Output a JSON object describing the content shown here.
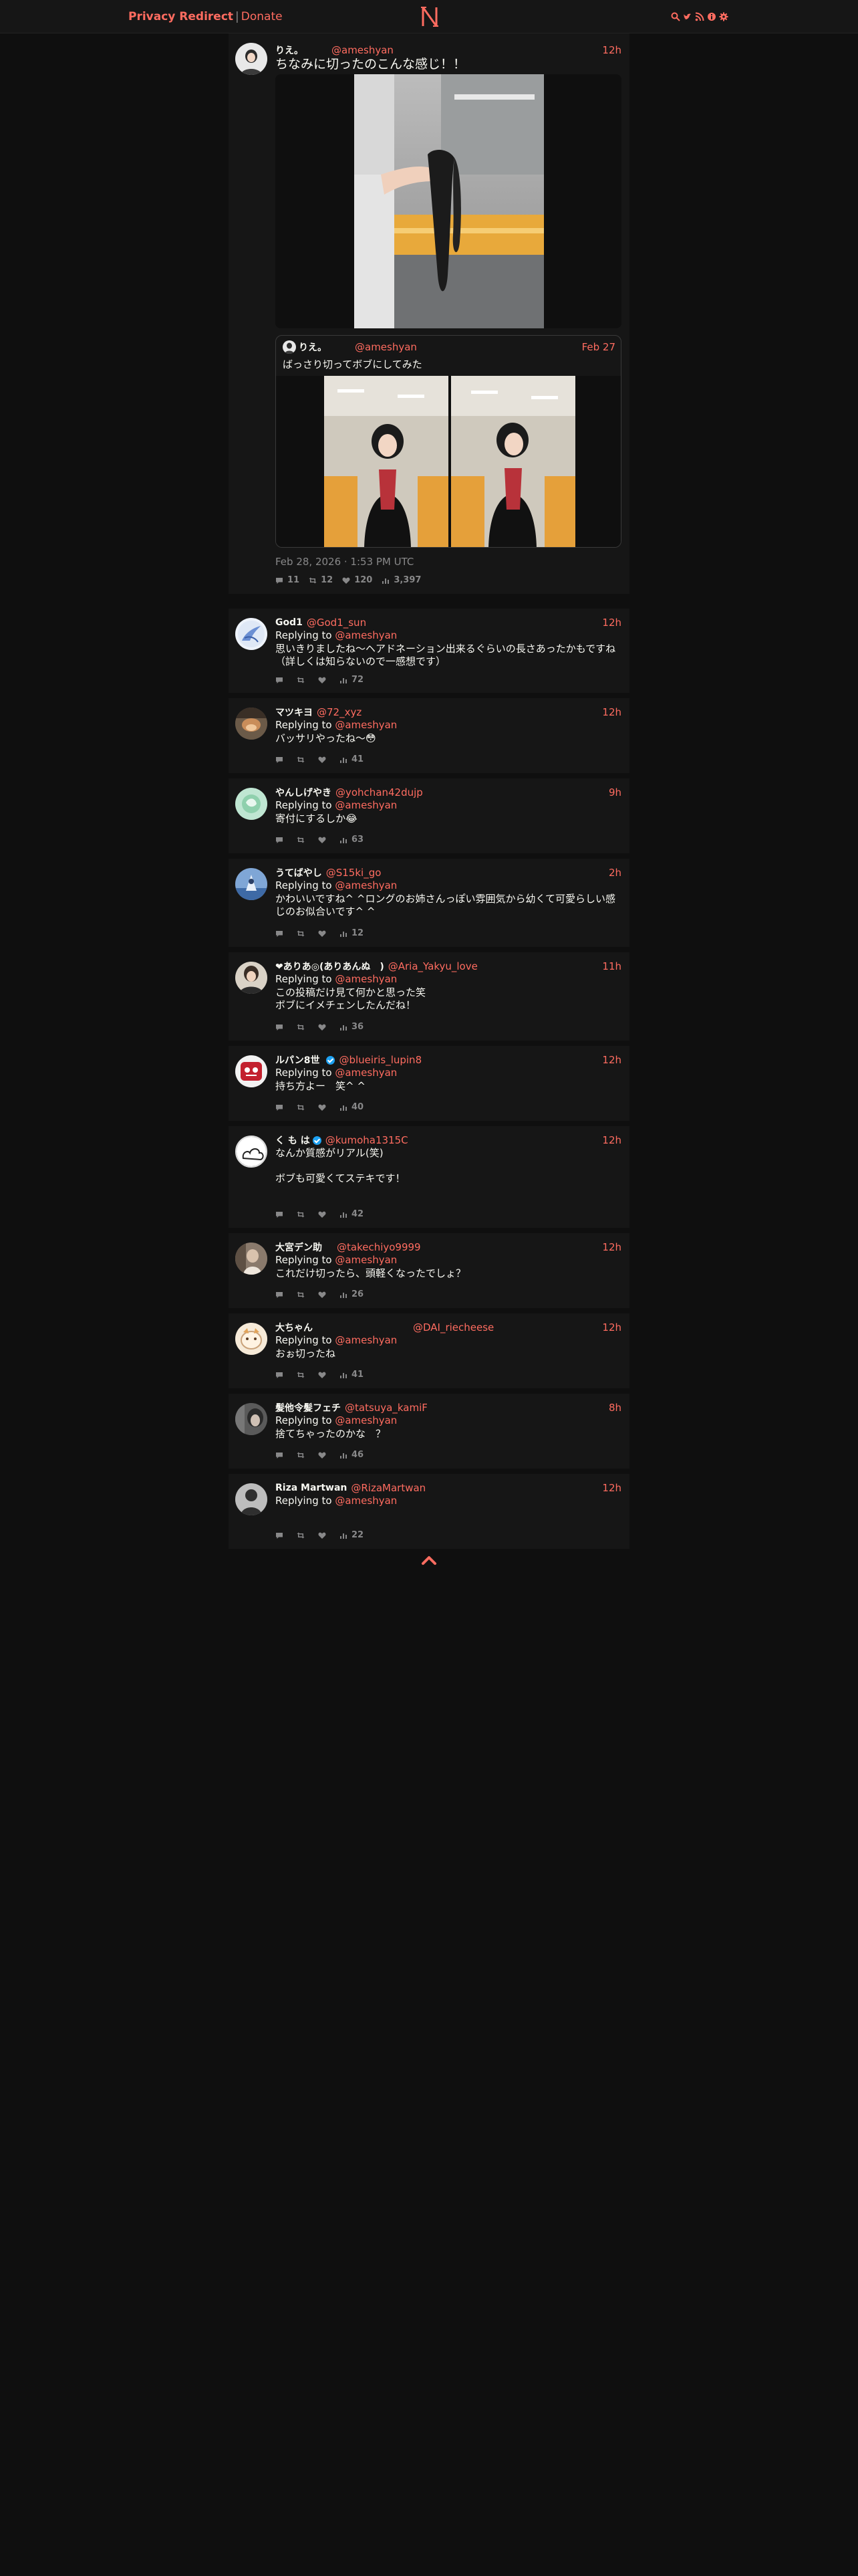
{
  "nav": {
    "brand": "Privacy Redirect",
    "separator": "|",
    "donate": "Donate",
    "logo_letter": "N",
    "icons": [
      "search-icon",
      "twitter-icon",
      "rss-icon",
      "info-icon",
      "gear-icon"
    ]
  },
  "colors": {
    "accent": "#ff6c60",
    "background": "#0f0f0f",
    "card": "#161616",
    "muted": "#888889"
  },
  "main_tweet": {
    "fullname": "りえ。",
    "username": "@ameshyan",
    "date": "12h",
    "text": "ちなみに切ったのこんな感じ！！",
    "published": "Feb 28, 2026 · 1:53 PM UTC",
    "stats": {
      "replies": "11",
      "retweets": "12",
      "likes": "120",
      "views": "3,397"
    },
    "quote": {
      "fullname": "りえ。",
      "username": "@ameshyan",
      "date": "Feb 27",
      "text": "ばっさり切ってボブにしてみた"
    }
  },
  "replies": [
    {
      "fullname": "God1",
      "username": "@God1_sun",
      "date": "12h",
      "replying_label": "Replying to",
      "replying_to": "@ameshyan",
      "text": "思いきりましたね〜ヘアドネーション出来るぐらいの長さあったかもですね（詳しくは知らないので一感想です）",
      "views": "72"
    },
    {
      "fullname": "マツキヨ",
      "username": "@72_xyz",
      "date": "12h",
      "replying_label": "Replying to",
      "replying_to": "@ameshyan",
      "text": "バッサリやったね〜😳",
      "views": "41"
    },
    {
      "fullname": "やんしげやき",
      "username": "@yohchan42dujp",
      "date": "9h",
      "replying_label": "Replying to",
      "replying_to": "@ameshyan",
      "text": "寄付にするしか😂",
      "views": "63"
    },
    {
      "fullname": "うてばやし",
      "username": "@S15ki_go",
      "date": "2h",
      "replying_label": "Replying to",
      "replying_to": "@ameshyan",
      "text": "かわいいですね^ ^ロングのお姉さんっぽい雰囲気から幼くて可愛らしい感じのお似合いです^ ^",
      "views": "12"
    },
    {
      "fullname": "❤ありあ◎(ありあんぬ　)",
      "username": "@Aria_Yakyu_love",
      "date": "11h",
      "replying_label": "Replying to",
      "replying_to": "@ameshyan",
      "text": "この投稿だけ見て何かと思った笑\nボブにイメチェンしたんだね！",
      "views": "36"
    },
    {
      "fullname": "ルパン8世",
      "username": "@blueiris_lupin8",
      "date": "12h",
      "replying_label": "Replying to",
      "replying_to": "@ameshyan",
      "text": "持ち方よー　笑^ ^",
      "views": "40"
    },
    {
      "fullname": "く も は",
      "username": "@kumoha1315C",
      "date": "12h",
      "replying_label": "",
      "replying_to": "",
      "text": "なんか質感がリアル(笑)\n\nボブも可愛くてステキです！",
      "views": "42"
    },
    {
      "fullname": "大宮デン助",
      "username": "@takechiyo9999",
      "date": "12h",
      "replying_label": "Replying to",
      "replying_to": "@ameshyan",
      "text": "これだけ切ったら、頭軽くなったでしょ？",
      "views": "26"
    },
    {
      "fullname": "大ちゃん",
      "username": "@DAI_riecheese",
      "date": "12h",
      "replying_label": "Replying to",
      "replying_to": "@ameshyan",
      "text": "おぉ切ったね",
      "views": "41"
    },
    {
      "fullname": "髪他令髪フェチ",
      "username": "@tatsuya_kamiF",
      "date": "8h",
      "replying_label": "Replying to",
      "replying_to": "@ameshyan",
      "text": "捨てちゃったのかな　？",
      "views": "46"
    },
    {
      "fullname": "Riza Martwan",
      "username": "@RizaMartwan",
      "date": "12h",
      "replying_label": "Replying to",
      "replying_to": "@ameshyan",
      "text": "",
      "views": "22"
    }
  ]
}
